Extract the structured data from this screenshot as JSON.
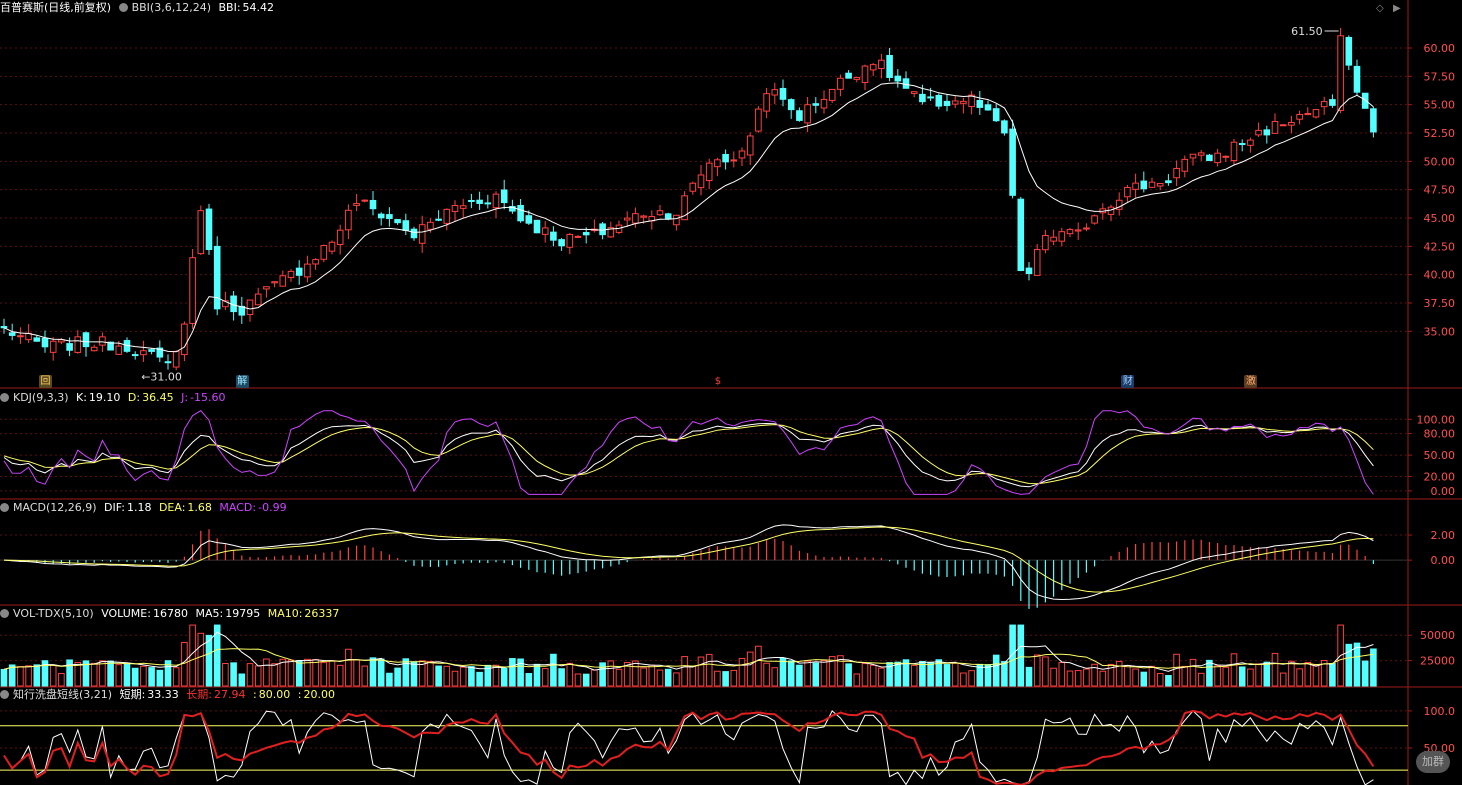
{
  "stock": {
    "name": "百普赛斯",
    "mode": "(日线,前复权)"
  },
  "colors": {
    "up": "#ff4040",
    "down": "#54ffff",
    "grid": "#5a1010",
    "axis": "#9b1b1b",
    "white": "#ffffff",
    "yellow": "#ffff66",
    "magenta": "#cc44ff",
    "label": "#dddddd"
  },
  "icons": {
    "toggle": "circle-chevron-icon",
    "diamond": "diamond-icon",
    "scroll": "scroll-arrow-icon"
  },
  "panels": {
    "main": {
      "indicator": "BBI(3,6,12,24)",
      "vals": [
        {
          "k": "BBI:",
          "v": "54.42"
        }
      ],
      "yticks": [
        "60.00",
        "57.50",
        "55.00",
        "52.50",
        "50.00",
        "47.50",
        "45.00",
        "42.50",
        "40.00",
        "37.50",
        "35.00"
      ],
      "high_label": "61.50",
      "low_label": "31.00"
    },
    "kdj": {
      "indicator": "KDJ(9,3,3)",
      "vals": [
        {
          "k": "K:",
          "v": "19.10"
        },
        {
          "k": "D:",
          "v": "36.45"
        },
        {
          "k": "J:",
          "v": "-15.60"
        }
      ],
      "yticks": [
        "100.00",
        "80.00",
        "50.00",
        "20.00",
        "0.00"
      ]
    },
    "macd": {
      "indicator": "MACD(12,26,9)",
      "vals": [
        {
          "k": "DIF:",
          "v": "1.18"
        },
        {
          "k": "DEA:",
          "v": "1.68"
        },
        {
          "k": "MACD:",
          "v": "-0.99"
        }
      ],
      "yticks": [
        "2.00",
        "0.00"
      ]
    },
    "vol": {
      "indicator": "VOL-TDX(5,10)",
      "vals": [
        {
          "k": "VOLUME:",
          "v": "16780"
        },
        {
          "k": "MA5:",
          "v": "19795"
        },
        {
          "k": "MA10:",
          "v": "26337"
        }
      ],
      "yticks": [
        "50000",
        "25000"
      ]
    },
    "wash": {
      "indicator": "知行洗盘短线(3,21)",
      "vals": [
        {
          "k": "短期:",
          "v": "33.33"
        },
        {
          "k": "长期:",
          "v": "27.94"
        },
        {
          "k": ":",
          "v": "80.00"
        },
        {
          "k": ":",
          "v": "20.00"
        }
      ],
      "yticks": [
        "100.0",
        "50.00"
      ]
    }
  },
  "event_markers": [
    {
      "text": "回",
      "bar": 5
    },
    {
      "text": "解",
      "bar": 29
    },
    {
      "text": "$",
      "bar": 87
    },
    {
      "text": "财",
      "bar": 137
    },
    {
      "text": "激",
      "bar": 152
    }
  ],
  "watermark": "加群",
  "chart_data": {
    "type": "candlestick",
    "bars": 168,
    "price": {
      "title": "百普赛斯(日线,前复权)",
      "ylim": [
        30.0,
        63.0
      ],
      "high_label": 61.5,
      "low_label": 31.0,
      "keypoints": [
        [
          0,
          35.2
        ],
        [
          5,
          33.6
        ],
        [
          10,
          34.0
        ],
        [
          15,
          33.8
        ],
        [
          20,
          32.0
        ],
        [
          22,
          35.5
        ],
        [
          23,
          41.5
        ],
        [
          24,
          46.0
        ],
        [
          26,
          37.5
        ],
        [
          29,
          37.0
        ],
        [
          36,
          40.5
        ],
        [
          40,
          43.0
        ],
        [
          43,
          46.5
        ],
        [
          47,
          45.0
        ],
        [
          50,
          43.5
        ],
        [
          55,
          46.0
        ],
        [
          60,
          47.0
        ],
        [
          63,
          45.0
        ],
        [
          68,
          43.0
        ],
        [
          72,
          43.5
        ],
        [
          78,
          45.5
        ],
        [
          82,
          45.5
        ],
        [
          86,
          50.0
        ],
        [
          90,
          50.5
        ],
        [
          93,
          56.5
        ],
        [
          97,
          54.0
        ],
        [
          102,
          57.0
        ],
        [
          106,
          59.0
        ],
        [
          109,
          57.0
        ],
        [
          112,
          55.0
        ],
        [
          118,
          55.5
        ],
        [
          122,
          52.5
        ],
        [
          124,
          40.5
        ],
        [
          125,
          40.0
        ],
        [
          127,
          43.5
        ],
        [
          131,
          43.5
        ],
        [
          133,
          45.5
        ],
        [
          137,
          47.5
        ],
        [
          142,
          48.5
        ],
        [
          144,
          50.0
        ],
        [
          148,
          50.5
        ],
        [
          153,
          52.5
        ],
        [
          158,
          54.0
        ],
        [
          162,
          55.0
        ],
        [
          163,
          60.5
        ],
        [
          164,
          59.0
        ],
        [
          165,
          56.0
        ],
        [
          167,
          53.0
        ]
      ]
    },
    "bbi_last": 54.42,
    "kdj": {
      "ylim": [
        -10,
        120
      ],
      "K_last": 19.1,
      "D_last": 36.45,
      "J_last": -15.6
    },
    "macd": {
      "ylim": [
        -3.5,
        3.6
      ],
      "DIF_last": 1.18,
      "DEA_last": 1.68,
      "MACD_last": -0.99
    },
    "volume": {
      "ylim": [
        0,
        64000
      ],
      "VOLUME_last": 16780,
      "MA5_last": 19795,
      "MA10_last": 26337
    },
    "wash": {
      "ylim": [
        0,
        112
      ],
      "short_last": 33.33,
      "long_last": 27.94,
      "hlines": [
        80.0,
        20.0
      ]
    }
  }
}
